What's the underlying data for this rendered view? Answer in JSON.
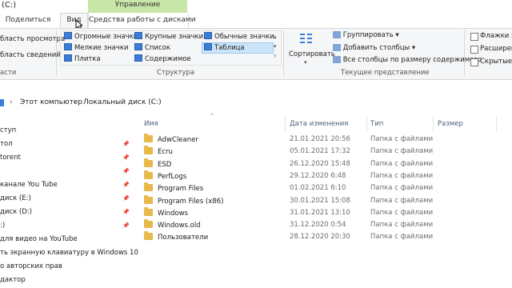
{
  "window": {
    "title": "(C:)"
  },
  "tabs": {
    "share": "Поделиться",
    "view": "Вид",
    "disk_tools": "Средства работы с дисками",
    "manage": "Управление"
  },
  "ribbon": {
    "panes": {
      "preview": "бласть просмотра",
      "details": "бласть сведений",
      "group_label": "асти"
    },
    "layout": {
      "items": [
        "Огромные значки",
        "Крупные значки",
        "Обычные значки",
        "Мелкие значки",
        "Список",
        "Таблица",
        "Плитка",
        "Содержимое"
      ],
      "selected": "Таблица",
      "group_label": "Структура"
    },
    "current_view": {
      "sort": "Сортировать",
      "group": "Группировать",
      "add_columns": "Добавить столбцы",
      "fit_columns": "Все столбцы по размеру содержимого",
      "group_label": "Текущее представление"
    },
    "show_hide": {
      "checkboxes": "Флажки эл",
      "extensions": "Расширени",
      "hidden": "Скрытые эл"
    }
  },
  "address": {
    "parts": [
      "Этот компьютер",
      "Локальный диск (C:)"
    ]
  },
  "nav": {
    "items": [
      {
        "label": "ступ",
        "pinned": false
      },
      {
        "label": "тол",
        "pinned": true
      },
      {
        "label": "torent",
        "pinned": true
      },
      {
        "label": "",
        "pinned": true
      },
      {
        "label": "канале You Tube",
        "pinned": true
      },
      {
        "label": "диск (E:)",
        "pinned": true
      },
      {
        "label": "диск (D:)",
        "pinned": true
      },
      {
        "label": ":)",
        "pinned": true
      },
      {
        "label": "для видео на YouTube",
        "pinned": false
      },
      {
        "label": "ть экранную клавиатуру в Windows 10",
        "pinned": false
      },
      {
        "label": "о авторских прав",
        "pinned": false
      },
      {
        "label": "дактор",
        "pinned": false
      }
    ]
  },
  "table": {
    "columns": [
      "Имя",
      "Дата изменения",
      "Тип",
      "Размер"
    ],
    "rows": [
      {
        "name": "AdwCleaner",
        "date": "21.01.2021 20:56",
        "type": "Папка с файлами"
      },
      {
        "name": "Ecru",
        "date": "05.01.2021 17:32",
        "type": "Папка с файлами"
      },
      {
        "name": "ESD",
        "date": "26.12.2020 15:48",
        "type": "Папка с файлами"
      },
      {
        "name": "PerfLogs",
        "date": "29.12.2020 6:48",
        "type": "Папка с файлами"
      },
      {
        "name": "Program Files",
        "date": "01.02.2021 6:10",
        "type": "Папка с файлами"
      },
      {
        "name": "Program Files (x86)",
        "date": "30.01.2021 15:08",
        "type": "Папка с файлами"
      },
      {
        "name": "Windows",
        "date": "31.01.2021 13:10",
        "type": "Папка с файлами"
      },
      {
        "name": "Windows.old",
        "date": "31.12.2020 0:54",
        "type": "Папка с файлами"
      },
      {
        "name": "Пользователи",
        "date": "28.12.2020 20:30",
        "type": "Папка с файлами"
      }
    ]
  },
  "colors": {
    "accent": "#3b7dd8",
    "manage_band": "#c7e6a8",
    "selected": "#cce4f7",
    "folder": "#e8b94a"
  }
}
